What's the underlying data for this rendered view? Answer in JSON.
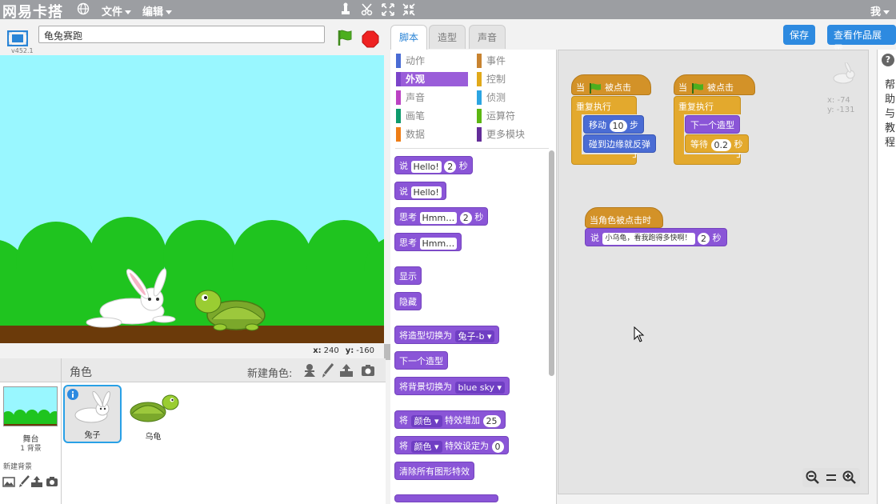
{
  "topbar": {
    "logo": "网易卡搭",
    "menu_file": "文件",
    "menu_edit": "编辑",
    "user": "我"
  },
  "project": {
    "title": "龟兔赛跑",
    "version": "v452.1"
  },
  "stage": {
    "x_label": "x:",
    "x_value": "240",
    "y_label": "y:",
    "y_value": "-160"
  },
  "sprites": {
    "header": "角色",
    "new_sprite": "新建角色:",
    "stage_name": "舞台",
    "stage_bg_count": "1 背景",
    "new_backdrop": "新建背景",
    "items": [
      {
        "name": "兔子",
        "selected": true
      },
      {
        "name": "乌龟",
        "selected": false
      }
    ]
  },
  "tabs": {
    "scripts": "脚本",
    "costumes": "造型",
    "sounds": "声音",
    "save": "保存",
    "view_showcase": "查看作品展示"
  },
  "categories": [
    {
      "label": "动作",
      "color": "#4a6cd4"
    },
    {
      "label": "事件",
      "color": "#c88330"
    },
    {
      "label": "外观",
      "color": "#8a55d7",
      "active": true
    },
    {
      "label": "控制",
      "color": "#e1a91a"
    },
    {
      "label": "声音",
      "color": "#bb42c3"
    },
    {
      "label": "侦测",
      "color": "#2ca5e2"
    },
    {
      "label": "画笔",
      "color": "#0e9a6c"
    },
    {
      "label": "运算符",
      "color": "#5cb712"
    },
    {
      "label": "数据",
      "color": "#ee7d16"
    },
    {
      "label": "更多模块",
      "color": "#632d99"
    }
  ],
  "palette_blocks": {
    "say_secs": {
      "label": "说",
      "text": "Hello!",
      "secs": "2",
      "unit": "秒"
    },
    "say": {
      "label": "说",
      "text": "Hello!"
    },
    "think_secs": {
      "label": "思考",
      "text": "Hmm…",
      "secs": "2",
      "unit": "秒"
    },
    "think": {
      "label": "思考",
      "text": "Hmm…"
    },
    "show": "显示",
    "hide": "隐藏",
    "switch_costume": {
      "label": "将造型切换为",
      "value": "兔子-b"
    },
    "next_costume": "下一个造型",
    "switch_backdrop": {
      "label": "将背景切换为",
      "value": "blue sky"
    },
    "change_effect": {
      "prefix": "将",
      "effect": "颜色",
      "label": "特效增加",
      "value": "25"
    },
    "set_effect": {
      "prefix": "将",
      "effect": "颜色",
      "label": "特效设定为",
      "value": "0"
    },
    "clear_effects": "清除所有图形特效"
  },
  "scripts": {
    "script1": {
      "hat_when": "当",
      "hat_clicked": "被点击",
      "forever": "重复执行",
      "move": "移动",
      "move_steps": "10",
      "steps_unit": "步",
      "bounce": "碰到边缘就反弹"
    },
    "script2": {
      "hat_when": "当",
      "hat_clicked": "被点击",
      "forever": "重复执行",
      "next_costume": "下一个造型",
      "wait": "等待",
      "wait_secs": "0.2",
      "secs_unit": "秒"
    },
    "script3": {
      "hat": "当角色被点击时",
      "say": "说",
      "text": "小乌龟，看我跑得多快啊！",
      "secs": "2",
      "secs_unit": "秒"
    },
    "readout_x": "x: -74",
    "readout_y": "y: -131"
  },
  "help": {
    "text": "帮助与教程"
  }
}
